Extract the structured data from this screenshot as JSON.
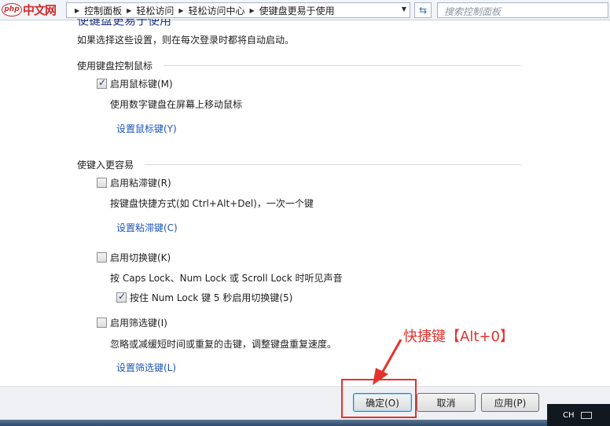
{
  "logo": {
    "mark": "php",
    "text": "中文网"
  },
  "address": {
    "breadcrumbs": [
      "控制面板",
      "轻松访问",
      "轻松访问中心",
      "使键盘更易于使用"
    ],
    "search_placeholder": "搜索控制面板"
  },
  "top": {
    "cut_title": "使键盘更易于使用",
    "description": "如果选择这些设置，则在每次登录时都将自动启动。"
  },
  "mouse_section": {
    "heading": "使用键盘控制鼠标",
    "mouse_keys": {
      "label": "启用鼠标键(M)",
      "checked": true
    },
    "mouse_keys_desc": "使用数字键盘在屏幕上移动鼠标",
    "mouse_keys_link": "设置鼠标键(Y)"
  },
  "easy_section": {
    "heading": "使键入更容易",
    "sticky": {
      "label": "启用粘滞键(R)",
      "checked": false
    },
    "sticky_desc": "按键盘快捷方式(如 Ctrl+Alt+Del)，一次一个键",
    "sticky_link": "设置粘滞键(C)",
    "toggle": {
      "label": "启用切换键(K)",
      "checked": false
    },
    "toggle_desc": "按 Caps Lock、Num Lock 或 Scroll Lock 时听见声音",
    "toggle_sub": {
      "label": "按住 Num Lock 键 5 秒启用切换键(5)",
      "checked": true
    },
    "filter": {
      "label": "启用筛选键(I)",
      "checked": false
    },
    "filter_desc": "忽略或减缓短时间或重复的击键，调整键盘重复速度。",
    "filter_link": "设置筛选键(L)"
  },
  "buttons": {
    "ok": "确定(O)",
    "cancel": "取消",
    "apply": "应用(P)"
  },
  "annotation": "快捷键【Alt+0】",
  "tray": {
    "lang": "CH"
  },
  "colors": {
    "link": "#1c55b8",
    "annotation": "#e4332d",
    "title": "#1e3287"
  }
}
